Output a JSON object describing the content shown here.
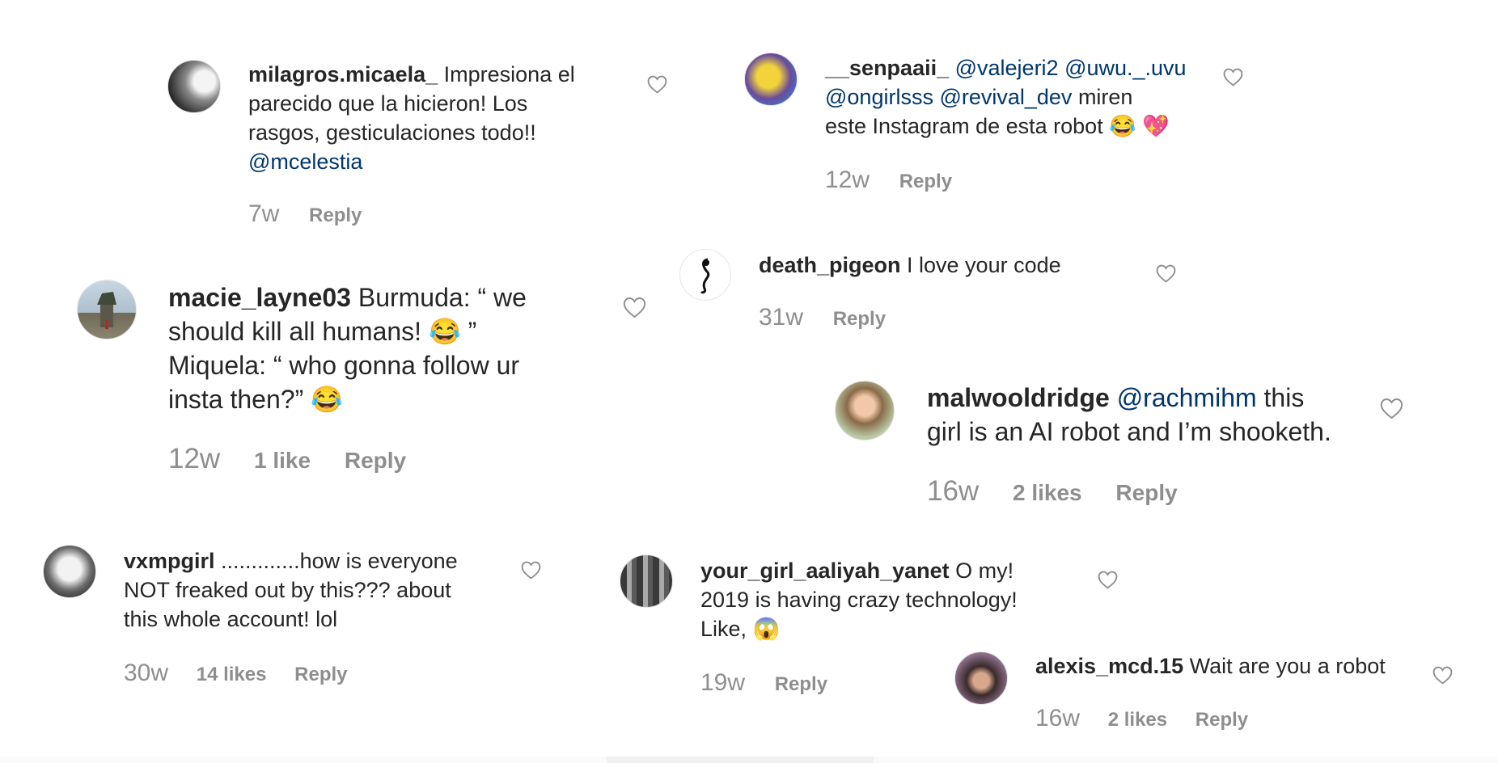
{
  "comments": [
    {
      "username": "milagros.micaela_",
      "text": " Impresiona el\nparecido que la hicieron! Los\nrasgos, gesticulaciones todo!!",
      "mention": "@mcelestia",
      "time": "7w",
      "reply": "Reply"
    },
    {
      "username": "__senpaaii_",
      "mentions_line1": " @valejeri2 @uwu._.uvu",
      "mentions_line2": "@ongirlsss @revival_dev",
      "text_after": " miren",
      "text_line3": "este Instagram de esta robot 😂 💖",
      "time": "12w",
      "reply": "Reply"
    },
    {
      "username": "death_pigeon",
      "text": " I love your code",
      "time": "31w",
      "reply": "Reply"
    },
    {
      "username": "macie_layne03",
      "text": " Burmuda: “ we\nshould kill all humans! 😂 ”\nMiquela: “ who gonna follow ur\ninsta then?” 😂",
      "time": "12w",
      "likes": "1 like",
      "reply": "Reply"
    },
    {
      "username": "malwooldridge",
      "mention": " @rachmihm",
      "text": " this\ngirl is an AI robot and I’m shooketh.",
      "time": "16w",
      "likes": "2 likes",
      "reply": "Reply"
    },
    {
      "username": "vxmpgirl",
      "text": " .............how is everyone\nNOT freaked out by this??? about\nthis whole account! lol",
      "time": "30w",
      "likes": "14 likes",
      "reply": "Reply"
    },
    {
      "username": "your_girl_aaliyah_yanet",
      "text": " O my!\n2019 is having crazy technology!\nLike, 😱",
      "time": "19w",
      "reply": "Reply"
    },
    {
      "username": "alexis_mcd.15",
      "text": " Wait are you a robot",
      "time": "16w",
      "likes": "2 likes",
      "reply": "Reply"
    }
  ],
  "icons": {
    "like": "heart-outline-icon"
  },
  "colors": {
    "text": "#262626",
    "username": "#262626",
    "mention": "#00376b",
    "meta": "#8e8e8e",
    "heart": "#8e8e8e"
  }
}
